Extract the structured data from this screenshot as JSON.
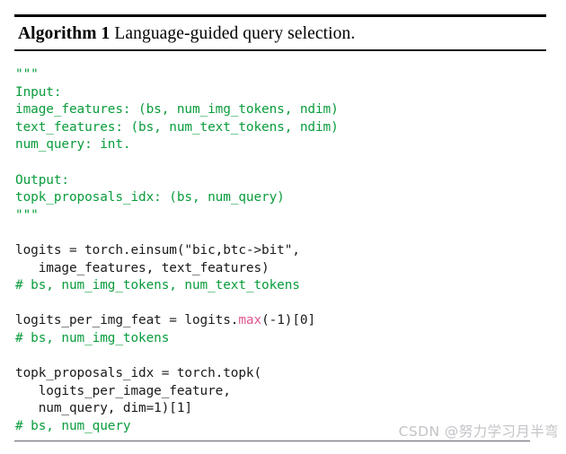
{
  "algorithm": {
    "label": "Algorithm 1",
    "caption": " Language-guided query selection.",
    "rule_color": "#000000"
  },
  "colors": {
    "docstring_green": "#0a9c3c",
    "comment_green": "#0a9c3c",
    "code_black": "#1a1a1a",
    "builtin_pink": "#e0568f",
    "watermark_gray": "#c3c3c8",
    "background": "#ffffff"
  },
  "code": {
    "language": "python",
    "lines": [
      {
        "id": "l01",
        "kind": "docstring",
        "text": "\"\"\""
      },
      {
        "id": "l02",
        "kind": "docstring",
        "text": "Input:"
      },
      {
        "id": "l03",
        "kind": "docstring",
        "text": "image_features: (bs, num_img_tokens, ndim)"
      },
      {
        "id": "l04",
        "kind": "docstring",
        "text": "text_features: (bs, num_text_tokens, ndim)"
      },
      {
        "id": "l05",
        "kind": "docstring",
        "text": "num_query: int."
      },
      {
        "id": "l06",
        "kind": "blank",
        "text": ""
      },
      {
        "id": "l07",
        "kind": "docstring",
        "text": "Output:"
      },
      {
        "id": "l08",
        "kind": "docstring",
        "text": "topk_proposals_idx: (bs, num_query)"
      },
      {
        "id": "l09",
        "kind": "docstring",
        "text": "\"\"\""
      },
      {
        "id": "l10",
        "kind": "blank",
        "text": ""
      },
      {
        "id": "l11",
        "kind": "code",
        "text": "logits = torch.einsum(\"bic,btc->bit\","
      },
      {
        "id": "l12",
        "kind": "code",
        "text": "   image_features, text_features)"
      },
      {
        "id": "l13",
        "kind": "comment",
        "text": "# bs, num_img_tokens, num_text_tokens"
      },
      {
        "id": "l14",
        "kind": "blank",
        "text": ""
      },
      {
        "id": "l15",
        "kind": "code-builtin",
        "text": "logits_per_img_feat = logits.max(-1)[0]",
        "pre": "logits_per_img_feat = logits.",
        "builtin": "max",
        "post": "(-1)[0]"
      },
      {
        "id": "l16",
        "kind": "comment",
        "text": "# bs, num_img_tokens"
      },
      {
        "id": "l17",
        "kind": "blank",
        "text": ""
      },
      {
        "id": "l18",
        "kind": "code",
        "text": "topk_proposals_idx = torch.topk("
      },
      {
        "id": "l19",
        "kind": "code",
        "text": "   logits_per_image_feature,"
      },
      {
        "id": "l20",
        "kind": "code",
        "text": "   num_query, dim=1)[1]"
      },
      {
        "id": "l21",
        "kind": "comment",
        "text": "# bs, num_query"
      }
    ]
  },
  "watermark": {
    "text": "CSDN @努力学习月半弯"
  }
}
